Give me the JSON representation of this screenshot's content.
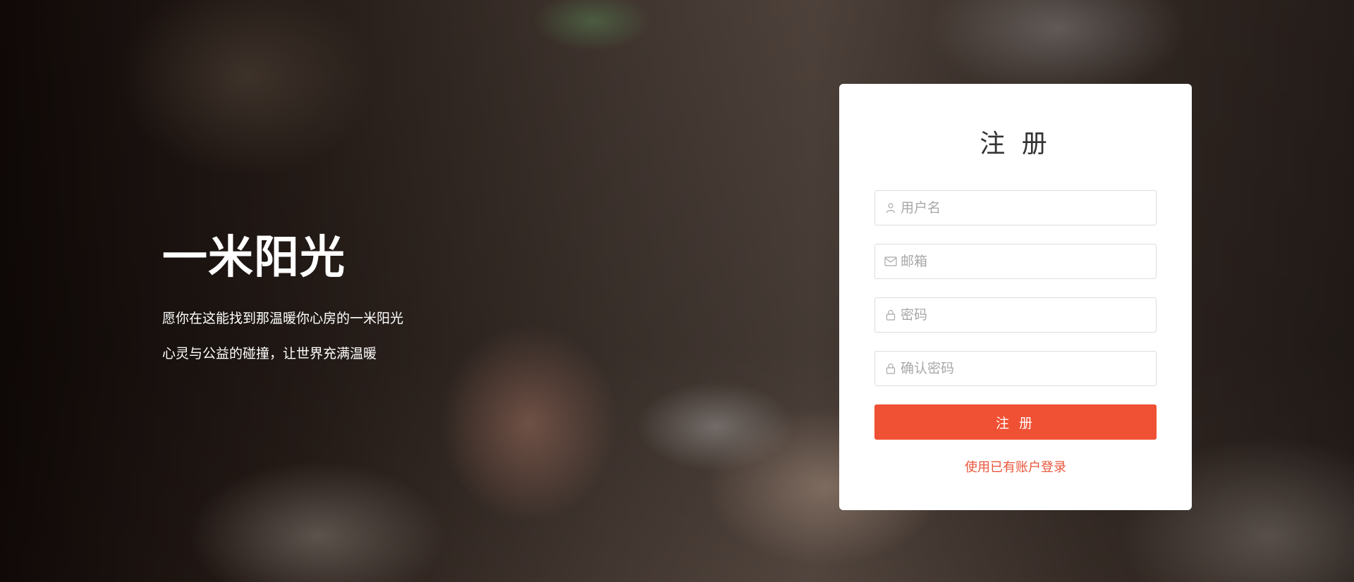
{
  "hero": {
    "title": "一米阳光",
    "line1": "愿你在这能找到那温暖你心房的一米阳光",
    "line2": "心灵与公益的碰撞，让世界充满温暖"
  },
  "register": {
    "title": "注 册",
    "fields": [
      {
        "icon": "user-icon",
        "placeholder": "用户名"
      },
      {
        "icon": "mail-icon",
        "placeholder": "邮箱"
      },
      {
        "icon": "lock-icon",
        "placeholder": "密码"
      },
      {
        "icon": "lock-icon",
        "placeholder": "确认密码"
      }
    ],
    "submit_label": "注 册",
    "login_link": "使用已有账户登录"
  },
  "colors": {
    "accent": "#f05033",
    "link": "#e9563b",
    "card_bg": "#ffffff",
    "input_border": "#dcdcdc",
    "placeholder": "#a8a8a8"
  }
}
